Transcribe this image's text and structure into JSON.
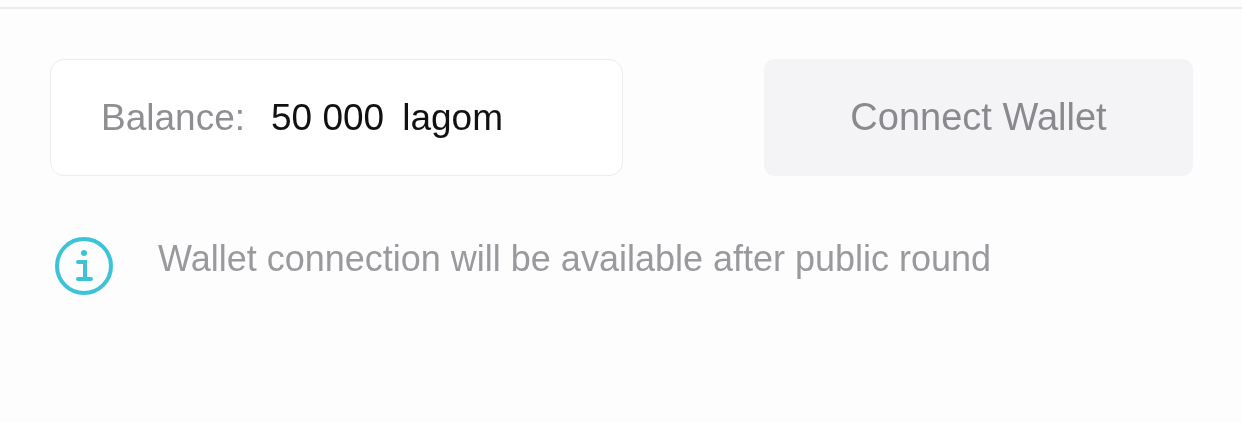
{
  "balance": {
    "label": "Balance:",
    "amount": "50 000",
    "unit": "lagom"
  },
  "connect_button": {
    "label": "Connect Wallet",
    "disabled": true
  },
  "notice": {
    "text": "Wallet connection will be available after public round"
  }
}
